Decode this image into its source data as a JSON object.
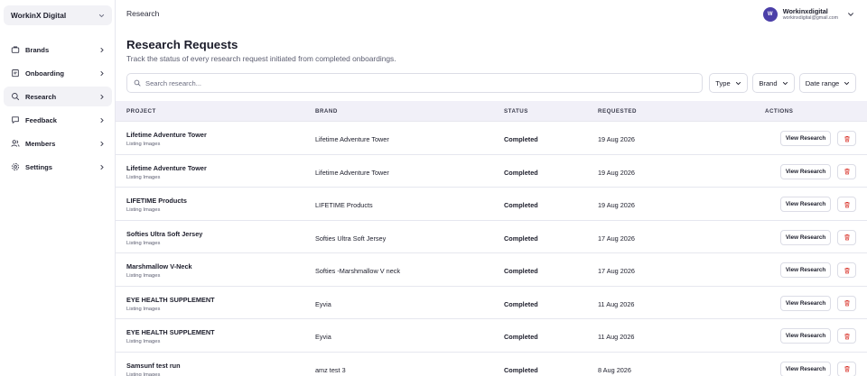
{
  "sidebar": {
    "workspace": "WorkinX Digital",
    "items": [
      {
        "label": "Brands",
        "icon": "briefcase-icon"
      },
      {
        "label": "Onboarding",
        "icon": "clipboard-icon"
      },
      {
        "label": "Research",
        "icon": "search-icon",
        "active": true
      },
      {
        "label": "Feedback",
        "icon": "message-icon"
      },
      {
        "label": "Members",
        "icon": "users-icon"
      },
      {
        "label": "Settings",
        "icon": "gear-icon"
      }
    ]
  },
  "topbar": {
    "breadcrumb": "Research",
    "user": {
      "initial": "W",
      "name": "Workinxdigital",
      "email": "workinxdigital@gmail.com"
    }
  },
  "header": {
    "title": "Research Requests",
    "subtitle": "Track the status of every research request initiated from completed onboardings."
  },
  "filters": {
    "search_placeholder": "Search research...",
    "type_label": "Type",
    "brand_label": "Brand",
    "date_label": "Date range"
  },
  "table": {
    "columns": [
      "PROJECT",
      "BRAND",
      "STATUS",
      "REQUESTED",
      "ACTIONS"
    ],
    "view_label": "View Research",
    "rows": [
      {
        "project": "Lifetime Adventure Tower",
        "type": "Listing Images",
        "brand": "Lifetime Adventure Tower",
        "status": "Completed",
        "requested": "19 Aug 2026"
      },
      {
        "project": "Lifetime Adventure Tower",
        "type": "Listing Images",
        "brand": "Lifetime Adventure Tower",
        "status": "Completed",
        "requested": "19 Aug 2026"
      },
      {
        "project": "LIFETIME Products",
        "type": "Listing Images",
        "brand": "LIFETIME Products",
        "status": "Completed",
        "requested": "19 Aug 2026"
      },
      {
        "project": "Softies Ultra Soft Jersey",
        "type": "Listing Images",
        "brand": "Softies Ultra Soft Jersey",
        "status": "Completed",
        "requested": "17 Aug 2026"
      },
      {
        "project": "Marshmallow V-Neck",
        "type": "Listing Images",
        "brand": "Softies -Marshmallow V neck",
        "status": "Completed",
        "requested": "17 Aug 2026"
      },
      {
        "project": "EYE HEALTH SUPPLEMENT",
        "type": "Listing Images",
        "brand": "Eyvia",
        "status": "Completed",
        "requested": "11 Aug 2026"
      },
      {
        "project": "EYE HEALTH SUPPLEMENT",
        "type": "Listing Images",
        "brand": "Eyvia",
        "status": "Completed",
        "requested": "11 Aug 2026"
      },
      {
        "project": "Samsunf test run",
        "type": "Listing Images",
        "brand": "amz test 3",
        "status": "Completed",
        "requested": "8 Aug 2026"
      }
    ]
  },
  "colors": {
    "accent": "#4b3fa8",
    "delete": "#d9342b",
    "header_bg": "#f1f0f8"
  }
}
